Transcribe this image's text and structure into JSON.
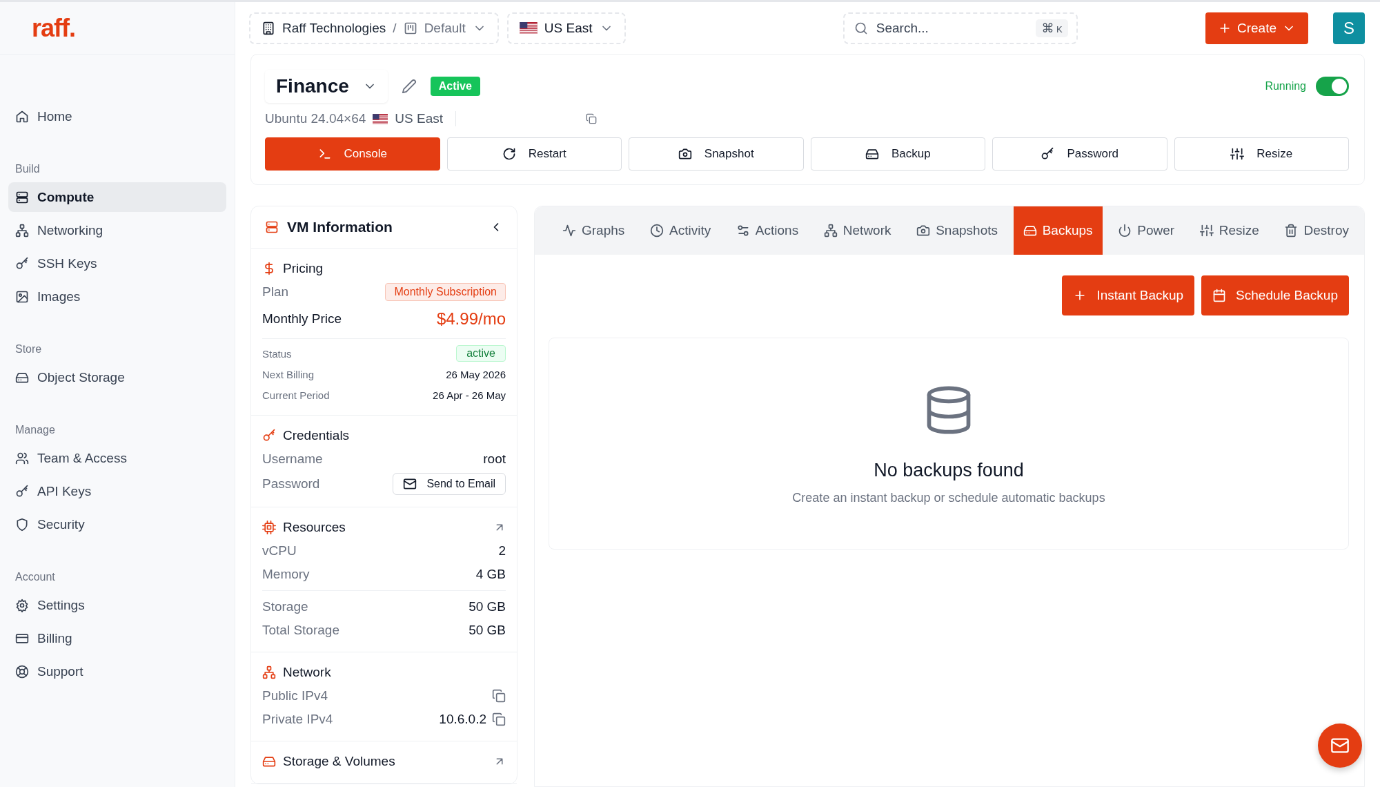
{
  "logo": "raff.",
  "topbar": {
    "organization": "Raff Technologies",
    "separator": "/",
    "project": "Default",
    "region": "US East",
    "search": {
      "placeholder": "Search...",
      "shortcut": [
        "⌘",
        "K"
      ]
    },
    "create_button": "Create",
    "avatar": "S"
  },
  "sidebar": {
    "sections": [
      {
        "items": [
          {
            "label": "Home",
            "selected": false
          }
        ]
      },
      {
        "title": "Build",
        "items": [
          {
            "label": "Compute",
            "selected": true
          },
          {
            "label": "Networking",
            "selected": false
          },
          {
            "label": "SSH Keys",
            "selected": false
          },
          {
            "label": "Images",
            "selected": false
          }
        ]
      },
      {
        "title": "Store",
        "items": [
          {
            "label": "Object Storage",
            "selected": false
          }
        ]
      },
      {
        "title": "Manage",
        "items": [
          {
            "label": "Team & Access",
            "selected": false
          },
          {
            "label": "API Keys",
            "selected": false
          },
          {
            "label": "Security",
            "selected": false
          }
        ]
      },
      {
        "title": "Account",
        "items": [
          {
            "label": "Settings",
            "selected": false
          },
          {
            "label": "Billing",
            "selected": false
          },
          {
            "label": "Support",
            "selected": false
          }
        ]
      }
    ]
  },
  "vm": {
    "name": "Finance",
    "status": "Active",
    "os": "Ubuntu 24.04×64",
    "region": "US East",
    "running_label": "Running",
    "running": true
  },
  "actions": [
    {
      "label": "Console",
      "kind": "primary"
    },
    {
      "label": "Restart",
      "kind": "default"
    },
    {
      "label": "Snapshot",
      "kind": "default"
    },
    {
      "label": "Backup",
      "kind": "default"
    },
    {
      "label": "Password",
      "kind": "default"
    },
    {
      "label": "Resize",
      "kind": "default"
    }
  ],
  "info_panel": {
    "title": "VM Information",
    "sections": [
      {
        "title": "Pricing",
        "link": false,
        "groups": [
          [
            {
              "label": "Plan",
              "value": "Monthly Subscription",
              "kind": "plan-badge"
            },
            {
              "label": "Monthly Price",
              "value": "$4.99/mo",
              "kind": "price"
            }
          ],
          [
            {
              "label": "Status",
              "value": "active",
              "kind": "status-badge"
            },
            {
              "label": "Next Billing",
              "value": "26 May 2026",
              "kind": "meta"
            },
            {
              "label": "Current Period",
              "value": "26 Apr - 26 May",
              "kind": "meta"
            }
          ]
        ]
      },
      {
        "title": "Credentials",
        "link": false,
        "groups": [
          [
            {
              "label": "Username",
              "value": "root",
              "kind": "text"
            },
            {
              "label": "Password",
              "value": "Send to Email",
              "kind": "email-button"
            }
          ]
        ]
      },
      {
        "title": "Resources",
        "link": true,
        "groups": [
          [
            {
              "label": "vCPU",
              "value": "2",
              "kind": "text"
            },
            {
              "label": "Memory",
              "value": "4 GB",
              "kind": "text"
            }
          ],
          [
            {
              "label": "Storage",
              "value": "50 GB",
              "kind": "text"
            },
            {
              "label": "Total Storage",
              "value": "50 GB",
              "kind": "text"
            }
          ]
        ]
      },
      {
        "title": "Network",
        "link": false,
        "groups": [
          [
            {
              "label": "Public IPv4",
              "kind": "copy"
            },
            {
              "label": "Private IPv4",
              "value": "10.6.0.2",
              "kind": "copy"
            }
          ]
        ]
      },
      {
        "title": "Storage & Volumes",
        "link": true
      }
    ]
  },
  "tabs": [
    {
      "label": "Graphs",
      "selected": false
    },
    {
      "label": "Activity",
      "selected": false
    },
    {
      "label": "Actions",
      "selected": false
    },
    {
      "label": "Network",
      "selected": false
    },
    {
      "label": "Snapshots",
      "selected": false
    },
    {
      "label": "Backups",
      "selected": true
    },
    {
      "label": "Power",
      "selected": false
    },
    {
      "label": "Resize",
      "selected": false
    },
    {
      "label": "Destroy",
      "selected": false
    }
  ],
  "backups": {
    "buttons": [
      "Instant Backup",
      "Schedule Backup"
    ],
    "empty_title": "No backups found",
    "empty_message": "Create an instant backup or schedule automatic backups"
  }
}
